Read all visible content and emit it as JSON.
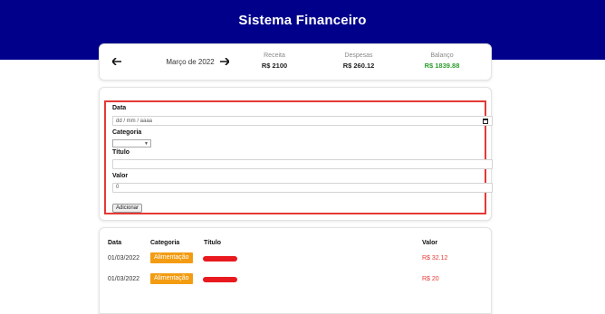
{
  "app": {
    "title": "Sistema Financeiro",
    "header_color": "#00008b"
  },
  "summary": {
    "prev_icon": "arrow-left-icon",
    "next_icon": "arrow-right-icon",
    "month": "Março de 2022",
    "income": {
      "label": "Receita",
      "value": "R$ 2100"
    },
    "expenses": {
      "label": "Despesas",
      "value": "R$ 260.12"
    },
    "balance": {
      "label": "Balanço",
      "value": "R$ 1839.88",
      "color": "#2e9e2e"
    }
  },
  "form": {
    "outline_color": "#e53935",
    "date": {
      "label": "Data",
      "placeholder": "dd / mm / aaaa"
    },
    "category": {
      "label": "Categoria",
      "selected": ""
    },
    "title": {
      "label": "Título",
      "value": ""
    },
    "value": {
      "label": "Valor",
      "value": "0"
    },
    "submit_label": "Adicionar"
  },
  "table": {
    "headers": [
      "Data",
      "Categoria",
      "Título",
      "Valor"
    ],
    "rows": [
      {
        "date": "01/03/2022",
        "category": "Alimentação",
        "title_redacted": true,
        "value": "R$ 32.12"
      },
      {
        "date": "01/03/2022",
        "category": "Alimentação",
        "title_redacted": true,
        "value": "R$ 20"
      }
    ],
    "category_color": "#f39c12",
    "value_color": "#e53935"
  }
}
